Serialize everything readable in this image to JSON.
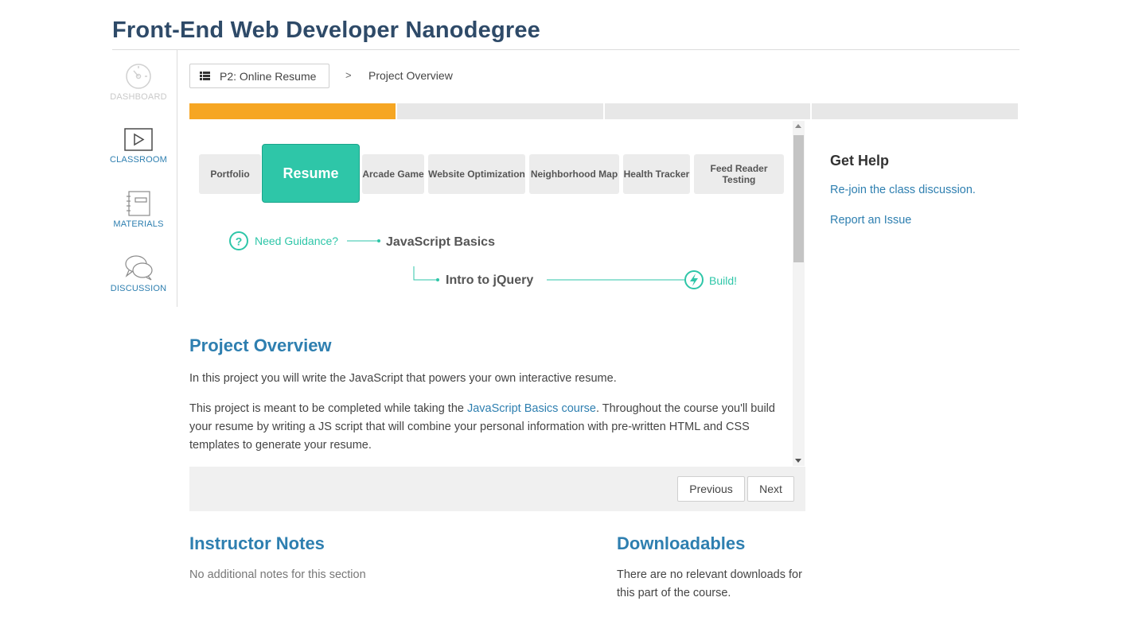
{
  "header": {
    "title": "Front-End Web Developer Nanodegree"
  },
  "leftnav": {
    "items": [
      {
        "label": "DASHBOARD",
        "icon": "dashboard-gauge-icon"
      },
      {
        "label": "CLASSROOM",
        "icon": "play-icon"
      },
      {
        "label": "MATERIALS",
        "icon": "notebook-icon"
      },
      {
        "label": "DISCUSSION",
        "icon": "chat-bubbles-icon"
      }
    ]
  },
  "breadcrumb": {
    "lesson_label": "P2: Online Resume",
    "separator": ">",
    "current": "Project Overview"
  },
  "progress": {
    "segments": 4,
    "active_index": 0,
    "active_color": "#f6a623",
    "inactive_color": "#e7e7e7"
  },
  "projects": {
    "tabs": [
      {
        "label": "Portfolio"
      },
      {
        "label": "Resume"
      },
      {
        "label": "Arcade Game"
      },
      {
        "label": "Website Optimization"
      },
      {
        "label": "Neighborhood Map"
      },
      {
        "label": "Health Tracker"
      },
      {
        "label": "Feed Reader Testing"
      }
    ],
    "active": "Resume",
    "active_color": "#2ec6a8"
  },
  "guidance": {
    "need_guidance": "Need Guidance?",
    "step1": "JavaScript Basics",
    "step2": "Intro to jQuery",
    "build": "Build!"
  },
  "content": {
    "heading": "Project Overview",
    "para1": "In this project you will write the JavaScript that powers your own interactive resume.",
    "para2_before": "This project is meant to be completed while taking the ",
    "para2_link": "JavaScript Basics course",
    "para2_after": ". Throughout the course you'll build your resume by writing a JS script that will combine your personal information with pre-written HTML and CSS templates to generate your resume."
  },
  "pager": {
    "previous": "Previous",
    "next": "Next"
  },
  "instructor_notes": {
    "heading": "Instructor Notes",
    "text": "No additional notes for this section"
  },
  "downloadables": {
    "heading": "Downloadables",
    "text": "There are no relevant downloads for this part of the course."
  },
  "help": {
    "heading": "Get Help",
    "links": [
      "Re-join the class discussion.",
      "Report an Issue"
    ]
  },
  "colors": {
    "title": "#2e4a68",
    "link": "#2e7fb0",
    "accent": "#2ec6a8"
  }
}
